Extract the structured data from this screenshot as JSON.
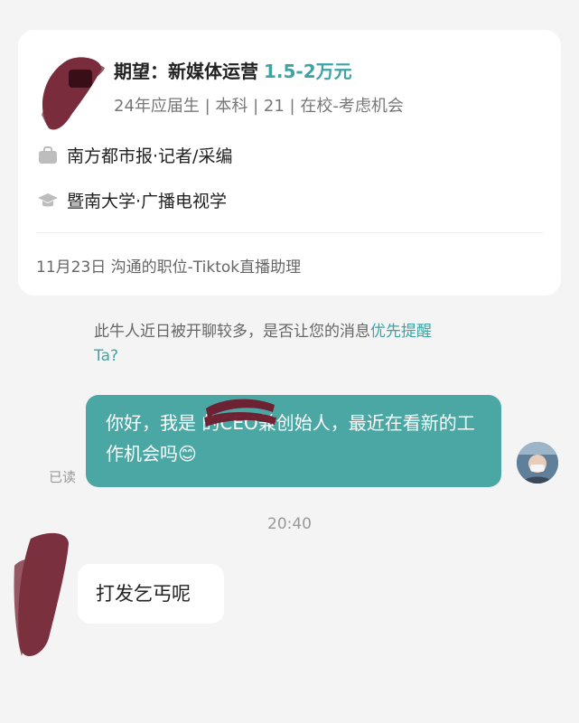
{
  "profile_card": {
    "title_prefix": "期望：新媒体运营",
    "salary": "1.5-2万元",
    "subtitle": "24年应届生 | 本科 | 21 | 在校-考虑机会",
    "job": "南方都市报·记者/采编",
    "school": "暨南大学·广播电视学",
    "footer": "11月23日  沟通的职位-Tiktok直播助理",
    "job_icon": "briefcase-icon",
    "school_icon": "graduation-cap-icon"
  },
  "notice": {
    "text": "此牛人近日被开聊较多，是否让您的消息",
    "link": "优先提醒",
    "suffix": "Ta?"
  },
  "messages": {
    "outgoing_text": "你好，我是               的CEO兼创始人，最近在看新的工作机会吗😊",
    "read_status": "已读",
    "time_separator": "20:40",
    "incoming_text": "打发乞丐呢"
  },
  "colors": {
    "accent": "#3fa3a5",
    "bubble_out": "#4ba7a3",
    "background": "#f4f4f4",
    "redaction": "#6e1b2c"
  }
}
